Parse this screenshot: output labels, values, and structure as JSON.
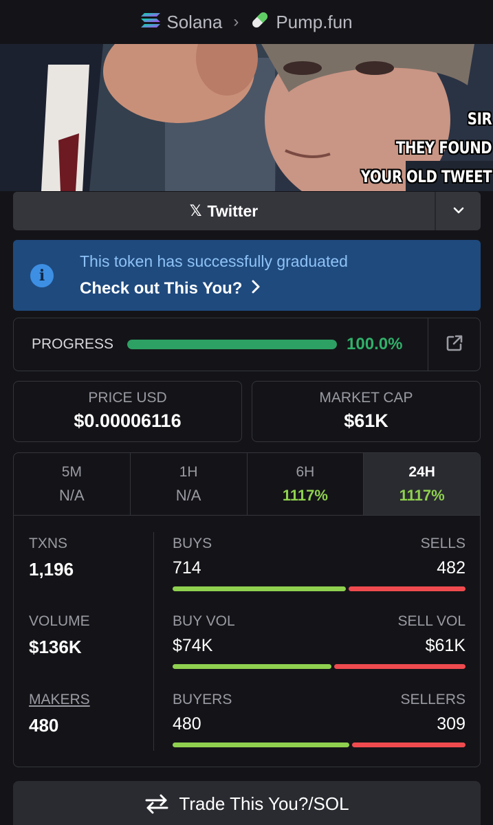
{
  "breadcrumb": {
    "chain": "Solana",
    "separator": "›",
    "platform": "Pump.fun"
  },
  "meme": {
    "caption_lines": [
      "SIR",
      "THEY FOUND",
      "YOUR OLD TWEET"
    ]
  },
  "twitter": {
    "icon": "x-logo-icon",
    "label": "Twitter"
  },
  "banner": {
    "message": "This token has successfully graduated",
    "link_label": "Check out This You?"
  },
  "progress": {
    "label": "PROGRESS",
    "value_text": "100.0%",
    "fraction": 1.0
  },
  "price": {
    "label": "PRICE USD",
    "value": "$0.00006116"
  },
  "market_cap": {
    "label": "MARKET CAP",
    "value": "$61K"
  },
  "timeframes": [
    {
      "label": "5M",
      "value": "N/A"
    },
    {
      "label": "1H",
      "value": "N/A"
    },
    {
      "label": "6H",
      "value": "1117%"
    },
    {
      "label": "24H",
      "value": "1117%",
      "selected": true
    }
  ],
  "metrics": {
    "txns": {
      "label": "TXNS",
      "value": "1,196"
    },
    "volume": {
      "label": "VOLUME",
      "value": "$136K"
    },
    "makers": {
      "label": "MAKERS",
      "value": "480"
    }
  },
  "splits": {
    "buys": {
      "left_label": "BUYS",
      "right_label": "SELLS",
      "left_value": "714",
      "right_value": "482",
      "left_fraction": 0.597
    },
    "vol": {
      "left_label": "BUY VOL",
      "right_label": "SELL VOL",
      "left_value": "$74K",
      "right_value": "$61K",
      "left_fraction": 0.548
    },
    "buyers": {
      "left_label": "BUYERS",
      "right_label": "SELLERS",
      "left_value": "480",
      "right_value": "309",
      "left_fraction": 0.608
    }
  },
  "trade": {
    "label": "Trade This You?/SOL"
  },
  "colors": {
    "accent_green": "#31b06a",
    "positive": "#8fd14f",
    "negative": "#ef4b4f",
    "banner_bg": "#1f4a7e"
  }
}
